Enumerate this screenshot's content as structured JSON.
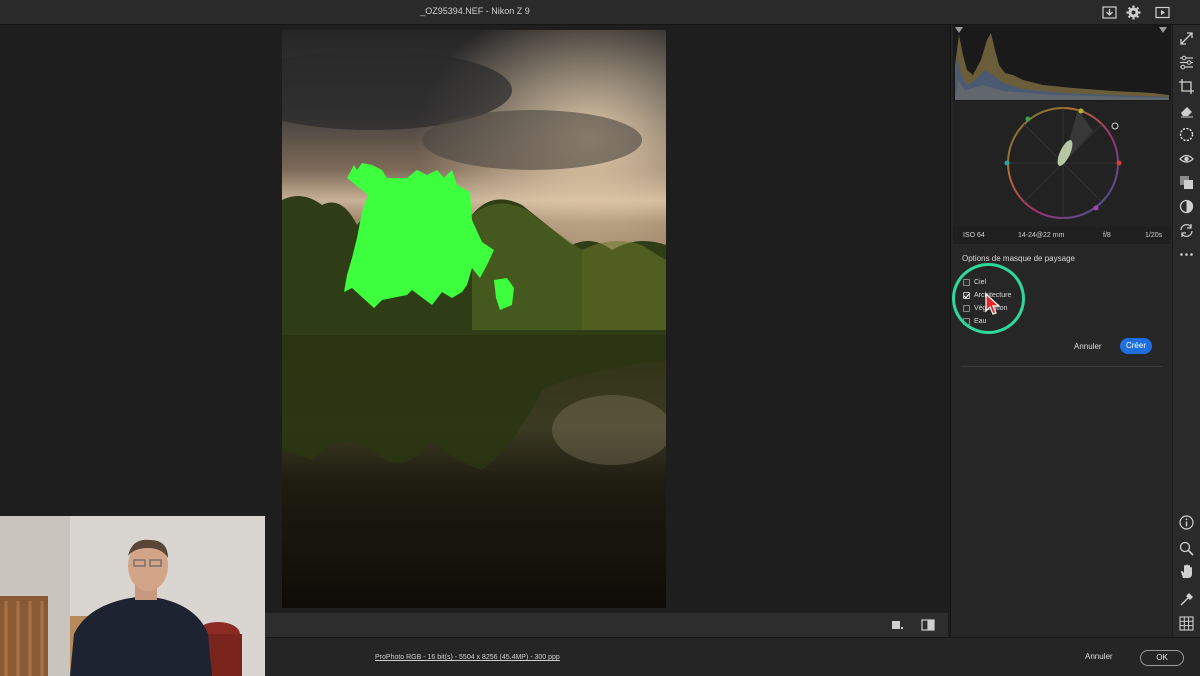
{
  "window": {
    "title": "_OZ95394.NEF  -  Nikon Z 9"
  },
  "titlebar_icons": [
    "download-icon",
    "gear-icon",
    "play-icon"
  ],
  "exif": {
    "iso": "ISO 64",
    "lens": "14-24@22 mm",
    "aperture": "f/8",
    "shutter": "1/20s"
  },
  "mask_panel": {
    "title": "Options de masque de paysage",
    "options": [
      {
        "label": "Ciel",
        "checked": false
      },
      {
        "label": "Architecture",
        "checked": true
      },
      {
        "label": "Végétation",
        "checked": false
      },
      {
        "label": "Eau",
        "checked": false
      }
    ],
    "cancel_label": "Annuler",
    "create_label": "Créer",
    "accent_color": "#1d6fe0",
    "highlight_color": "#2fd89a"
  },
  "status_bar": {
    "color_info": "ProPhoto RGB - 16 bit(s) - 5504 x 8256 (45.4MP) - 300 ppp",
    "cancel_label": "Annuler",
    "ok_label": "OK"
  },
  "mask_overlay_color": "#3dff3d",
  "toolbar": [
    "expand-icon",
    "adjust-sliders-icon",
    "crop-icon",
    "eraser-icon",
    "masking-icon",
    "redeye-icon",
    "layers-icon",
    "presets-icon",
    "sync-icon",
    "more-icon",
    "info-icon",
    "zoom-icon",
    "hand-icon",
    "eyedropper-icon",
    "grid-icon"
  ]
}
